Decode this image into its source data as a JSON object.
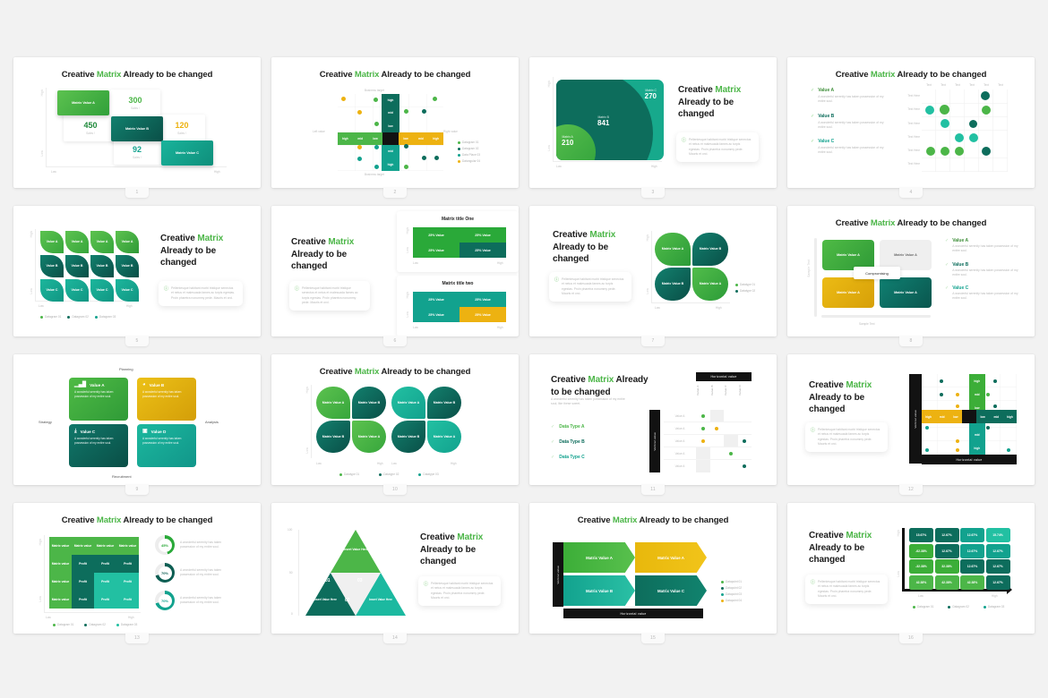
{
  "page": {
    "background": "#f2f2f2",
    "slide_count": 16,
    "columns": 4,
    "rows": 4
  },
  "brand": {
    "green": "#4cb648",
    "green_dark": "#1f8a3b",
    "teal": "#12a28e",
    "teal_dark": "#0d5e53",
    "yellow": "#edb211",
    "black": "#121212"
  },
  "common": {
    "title_a": "Creative ",
    "title_hl": "Matrix",
    "title_b": " Already to be changed",
    "title_stack_b": " Already to be",
    "title_stack_c": "changed",
    "low": "Low",
    "high": "High",
    "note": "Pellentesque habitant morbi tristique senectus et netus et malesuada fames ac turpis egestas. Proin pharetra nonummy pede. Mauris et orci.",
    "body_short": "A wonderful serenity has taken possession of my entire soul.",
    "info_icon": "info-icon",
    "check_icon": "check-icon"
  },
  "slides": [
    {
      "n": "1",
      "name": "offset-value-matrix",
      "tiles": [
        {
          "label": "Matrix Value A",
          "color": "#4cb648"
        },
        {
          "label": "Matrix Value B",
          "color": "#0d5e53"
        },
        {
          "label": "Matrix Value C",
          "color": "#12a28e"
        }
      ],
      "stats": [
        {
          "value": "300",
          "sub": "Sales !",
          "color": "#4cb648"
        },
        {
          "value": "450",
          "sub": "Sales !",
          "color": "#1f8a3b"
        },
        {
          "value": "120",
          "sub": "Sales !",
          "color": "#edb211"
        },
        {
          "value": "92",
          "sub": "Sales !",
          "color": "#12a28e"
        }
      ],
      "axis": {
        "x_low": "Low",
        "x_high": "High",
        "y_high": "High",
        "y_low": "Low"
      }
    },
    {
      "n": "2",
      "name": "cross-quadrant-scatter",
      "top_axis": "Business target",
      "bottom_axis": "Business target",
      "left_axis": "Left value",
      "right_axis": "Right value",
      "v_labels": [
        "high",
        "mid",
        "low",
        "low",
        "mid",
        "high"
      ],
      "h_left": [
        "high",
        "mid",
        "low"
      ],
      "h_right": [
        "low",
        "mid",
        "high"
      ],
      "legend": [
        "Datagram 01",
        "Datagram 02",
        "Data Place 03",
        "Datangular 04"
      ]
    },
    {
      "n": "3",
      "name": "nested-bubble-matrix",
      "circles": [
        {
          "label": "Matrix C",
          "value": "270",
          "color": "#17a98c"
        },
        {
          "label": "Matrix B",
          "value": "841",
          "color": "#0d6d5c"
        },
        {
          "label": "Matrix A",
          "value": "210",
          "color": "#4cb648"
        }
      ],
      "axis": {
        "x_low": "Low",
        "x_high": "High",
        "y_high": "High",
        "y_low": "Low"
      }
    },
    {
      "n": "4",
      "name": "bubble-grid-values",
      "values": [
        {
          "title": "Value A",
          "body": "A wonderful serenity has taken possession of my entire soul."
        },
        {
          "title": "Value B",
          "body": "A wonderful serenity has taken possession of my entire soul."
        },
        {
          "title": "Value C",
          "body": "A wonderful serenity has taken possession of my entire soul."
        }
      ],
      "col_headers": [
        "Text",
        "Text",
        "Text",
        "Text",
        "Text",
        "Text"
      ],
      "row_labels": [
        "Text Here",
        "Text Here",
        "Text Here",
        "Text Here",
        "Text Here",
        "Text Here"
      ]
    },
    {
      "n": "5",
      "name": "leaf-tile-grid-3x4",
      "rows": [
        {
          "label": "Value A",
          "color": "#4cb648"
        },
        {
          "label": "Value B",
          "color": "#0d5e53"
        },
        {
          "label": "Value C",
          "color": "#12a28e"
        }
      ],
      "legend": [
        "Datagram 01",
        "Datagram 02",
        "Datagram 03"
      ],
      "axis": {
        "x_low": "Low",
        "x_high": "High"
      }
    },
    {
      "n": "6",
      "name": "dual-quadrant-tables",
      "chart_one_title": "Matrix title One",
      "chart_two_title": "Matrix title two",
      "cell_label": "25% Value",
      "one_colors": [
        "#2aa939",
        "#2aa939",
        "#2aa939",
        "#0d6d5c"
      ],
      "two_colors": [
        "#12a28e",
        "#12a28e",
        "#12a28e",
        "#edb211"
      ],
      "axis": {
        "x_low": "Low",
        "x_high": "High",
        "y_high": "High",
        "y_low": "Low"
      }
    },
    {
      "n": "7",
      "name": "four-petal-matrix",
      "petals": [
        {
          "label": "Matrix Value A",
          "color": "#2aa939"
        },
        {
          "label": "Matrix Value B",
          "color": "#0d5e53"
        },
        {
          "label": "Matrix Value B",
          "color": "#0d5e53"
        },
        {
          "label": "Matrix Value A",
          "color": "#2aa939"
        }
      ],
      "legend": [
        "Datatype 01",
        "Datatype 02"
      ],
      "axis": {
        "x_low": "Low",
        "x_high": "High"
      }
    },
    {
      "n": "8",
      "name": "compromising-matrix",
      "center_label": "Compromising",
      "boxes": [
        {
          "label": "Matrix Value A",
          "color": "#3cae38"
        },
        {
          "label": "Matrix Value A",
          "color": "#efefef",
          "text": "#6b6b6b"
        },
        {
          "label": "Matrix Value A",
          "color": "#e0a70d"
        },
        {
          "label": "Matrix Value A",
          "color": "#0d6d5c"
        }
      ],
      "values": [
        {
          "title": "Value A",
          "body": "A wonderful serenity has taken possession of my entire soul."
        },
        {
          "title": "Value B",
          "body": "A wonderful serenity has taken possession of my entire soul."
        },
        {
          "title": "Value C",
          "body": "A wonderful serenity has taken possession of my entire soul."
        }
      ],
      "x_axis": "Sample Text",
      "y_axis": "Sample Text"
    },
    {
      "n": "9",
      "name": "icon-quadrant-cards",
      "top": "Planning",
      "bottom": "Recruitment",
      "left": "Strategy",
      "right": "Analysis",
      "cards": [
        {
          "title": "Value A",
          "icon": "bar-chart-icon",
          "glyph": "▊",
          "color": "#3cae38",
          "body": "A wonderful serenity has taken possession of my entire soul."
        },
        {
          "title": "Value B",
          "icon": "pie-chart-icon",
          "glyph": "◕",
          "color": "#e0b111",
          "body": "A wonderful serenity has taken possession of my entire soul."
        },
        {
          "title": "Value C",
          "icon": "download-icon",
          "glyph": "⤓",
          "color": "#0d5e53",
          "body": "A wonderful serenity has taken possession of my entire soul."
        },
        {
          "title": "Value D",
          "icon": "layers-icon",
          "glyph": "▣",
          "color": "#12a28e",
          "body": "A wonderful serenity has taken possession of my entire soul."
        }
      ]
    },
    {
      "n": "10",
      "name": "dual-petal-grid",
      "left_cells": [
        {
          "label": "Matrix Value A",
          "color": "#4cb648"
        },
        {
          "label": "Matrix Value B",
          "color": "#0d5e53"
        },
        {
          "label": "Matrix Value B",
          "color": "#0d5e53"
        },
        {
          "label": "Matrix Value A",
          "color": "#4cb648"
        }
      ],
      "right_cells": [
        {
          "label": "Matrix Value A",
          "color": "#12a28e"
        },
        {
          "label": "Matrix Value B",
          "color": "#0d5e53"
        },
        {
          "label": "Matrix Value B",
          "color": "#0d5e53"
        },
        {
          "label": "Matrix Value A",
          "color": "#12a28e"
        }
      ],
      "legend": [
        "Datatype 01",
        "Datatype 02",
        "Datatype 03"
      ],
      "axis": {
        "x_low": "Low",
        "x_high": "High"
      }
    },
    {
      "n": "11",
      "name": "data-type-grid-table",
      "subtitle": "A wonderful serenity has taken possession of my entire soul, like these sweet.",
      "checks": [
        {
          "label": "Data Type A",
          "color": "#4cb648"
        },
        {
          "label": "Data Type B",
          "color": "#0d6d5c"
        },
        {
          "label": "Data Type C",
          "color": "#12a28e"
        }
      ],
      "horizontal_label": "Horizontal value",
      "vertical_label": "Vertical value",
      "col_headers": [
        "Value A",
        "Value B",
        "Value C",
        "Value D"
      ],
      "row_headers": [
        "Value A",
        "Value A",
        "Value A",
        "Value A",
        "Value A"
      ]
    },
    {
      "n": "12",
      "name": "cross-scatter-dark-frame",
      "horizontal_label": "Horizontal value",
      "vertical_label": "Vertical value",
      "v_labels": [
        "high",
        "mid",
        "low",
        "low",
        "mid",
        "high"
      ],
      "h_left": [
        "high",
        "mid",
        "low"
      ],
      "h_right": [
        "low",
        "mid",
        "high"
      ]
    },
    {
      "n": "13",
      "name": "matrix-grid-with-donuts",
      "cells": [
        "Matrix value",
        "Profit"
      ],
      "donuts": [
        {
          "pct": "45%",
          "value": 45,
          "color": "#2aa939",
          "body": "A wonderful serenity has taken possession of my entire soul."
        },
        {
          "pct": "70%",
          "value": 70,
          "color": "#0d5e53",
          "body": "A wonderful serenity has taken possession of my entire soul."
        },
        {
          "pct": "70%",
          "value": 70,
          "color": "#12a28e",
          "body": "A wonderful serenity has taken possession of my entire soul."
        }
      ],
      "legend": [
        "Datagram 01",
        "Datagram 02",
        "Datagram 03"
      ],
      "axis": {
        "x_low": "Low",
        "x_high": "High",
        "y_high": "High",
        "y_low": "Low"
      }
    },
    {
      "n": "14",
      "name": "triangle-three-part",
      "segments": [
        {
          "num": "01",
          "label": "Insert Value Here",
          "color": "#0d6d5c"
        },
        {
          "num": "02",
          "label": "Insert Value Here",
          "color": "#0d6d5c"
        },
        {
          "num": "03",
          "label": "Insert Value Here",
          "color": "#12a28e"
        }
      ],
      "top_label": "Insert Value Here",
      "y_ticks": [
        "100",
        "50",
        "0"
      ]
    },
    {
      "n": "15",
      "name": "arrow-quadrant-matrix",
      "arrows": [
        {
          "label": "Matrix Value A",
          "color": "#3cae38"
        },
        {
          "label": "Matrix Value A",
          "color": "#e8b80c"
        },
        {
          "label": "Matrix Value B",
          "color": "#12a28e"
        },
        {
          "label": "Matrix Value C",
          "color": "#0d6d5c"
        }
      ],
      "horizontal_label": "Horizontal value",
      "vertical_label": "Vertical value",
      "legend": [
        "Datapoint 01",
        "Datapoint 02",
        "Datapoint 03",
        "Datapoint 04"
      ]
    },
    {
      "n": "16",
      "name": "percent-heatmap-grid",
      "grid": [
        [
          "15.67%",
          "12.67%",
          "12.67%",
          "15.74%"
        ],
        [
          "-62.38%",
          "12.67%",
          "12.67%",
          "12.67%"
        ],
        [
          "-32.38%",
          "32.38%",
          "12.67%",
          "12.67%"
        ],
        [
          "42.38%",
          "42.38%",
          "42.38%",
          "12.67%"
        ]
      ],
      "colors": [
        [
          "#0d6d5c",
          "#0d6d5c",
          "#12a28e",
          "#22c0a2"
        ],
        [
          "#3cae38",
          "#0d6d5c",
          "#12a28e",
          "#12a28e"
        ],
        [
          "#3cae38",
          "#3cae38",
          "#0d6d5c",
          "#0d6d5c"
        ],
        [
          "#4cb648",
          "#4cb648",
          "#4cb648",
          "#0d6d5c"
        ]
      ],
      "legend": [
        "Datagram 01",
        "Datagram 02",
        "Datagram 03"
      ],
      "axis": {
        "x_low": "Low",
        "x_high": "High",
        "y_high": "High",
        "y_low": "Low"
      }
    }
  ]
}
